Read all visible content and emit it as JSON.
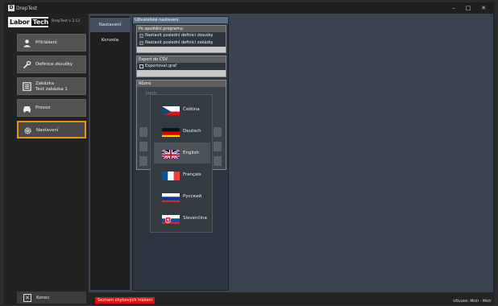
{
  "window": {
    "title": "DrepTest",
    "minimize": "–",
    "maximize": "□",
    "close": "✕"
  },
  "brand": {
    "logo_left": "Labor",
    "logo_right": "Tech",
    "version": "DrepTest v 3.12"
  },
  "sidebar": {
    "items": [
      {
        "label": "Přihlášení",
        "icon": "user-icon"
      },
      {
        "label": "Definice zkoušky",
        "icon": "wrench-icon"
      },
      {
        "label_line1": "Zakázka",
        "label_line2": "Test zakázka 1",
        "icon": "list-icon"
      },
      {
        "label": "Provoz",
        "icon": "car-icon"
      },
      {
        "label": "Nastavení",
        "icon": "gear-icon",
        "active": true
      }
    ],
    "exit_label": "Konec"
  },
  "tabs": [
    {
      "label": "Nastavení",
      "active": true
    },
    {
      "label": "Konzola",
      "active": false
    }
  ],
  "panel": {
    "header": "Uživatelské nastavení",
    "sections": {
      "startup": {
        "title": "Po spuštění programu",
        "options": [
          "Nastavit poslední definici zkoušky",
          "Nastavit poslední definici zakázky"
        ]
      },
      "export": {
        "title": "Export do CSV",
        "options": [
          "Exportovat graf"
        ]
      },
      "misc": {
        "title": "Různé"
      }
    }
  },
  "language": {
    "title": "Jazyk",
    "selected": "English",
    "options": [
      "Čeština",
      "Deutsch",
      "English",
      "Français",
      "Русский",
      "Slovenčina"
    ]
  },
  "status": {
    "error_list": "Seznam chybových hlášení",
    "user": "Uživatel: Mistr - Mistr"
  },
  "colors": {
    "accent": "#e8920f",
    "error": "#e01010",
    "panel_header": "#5b6f84"
  }
}
